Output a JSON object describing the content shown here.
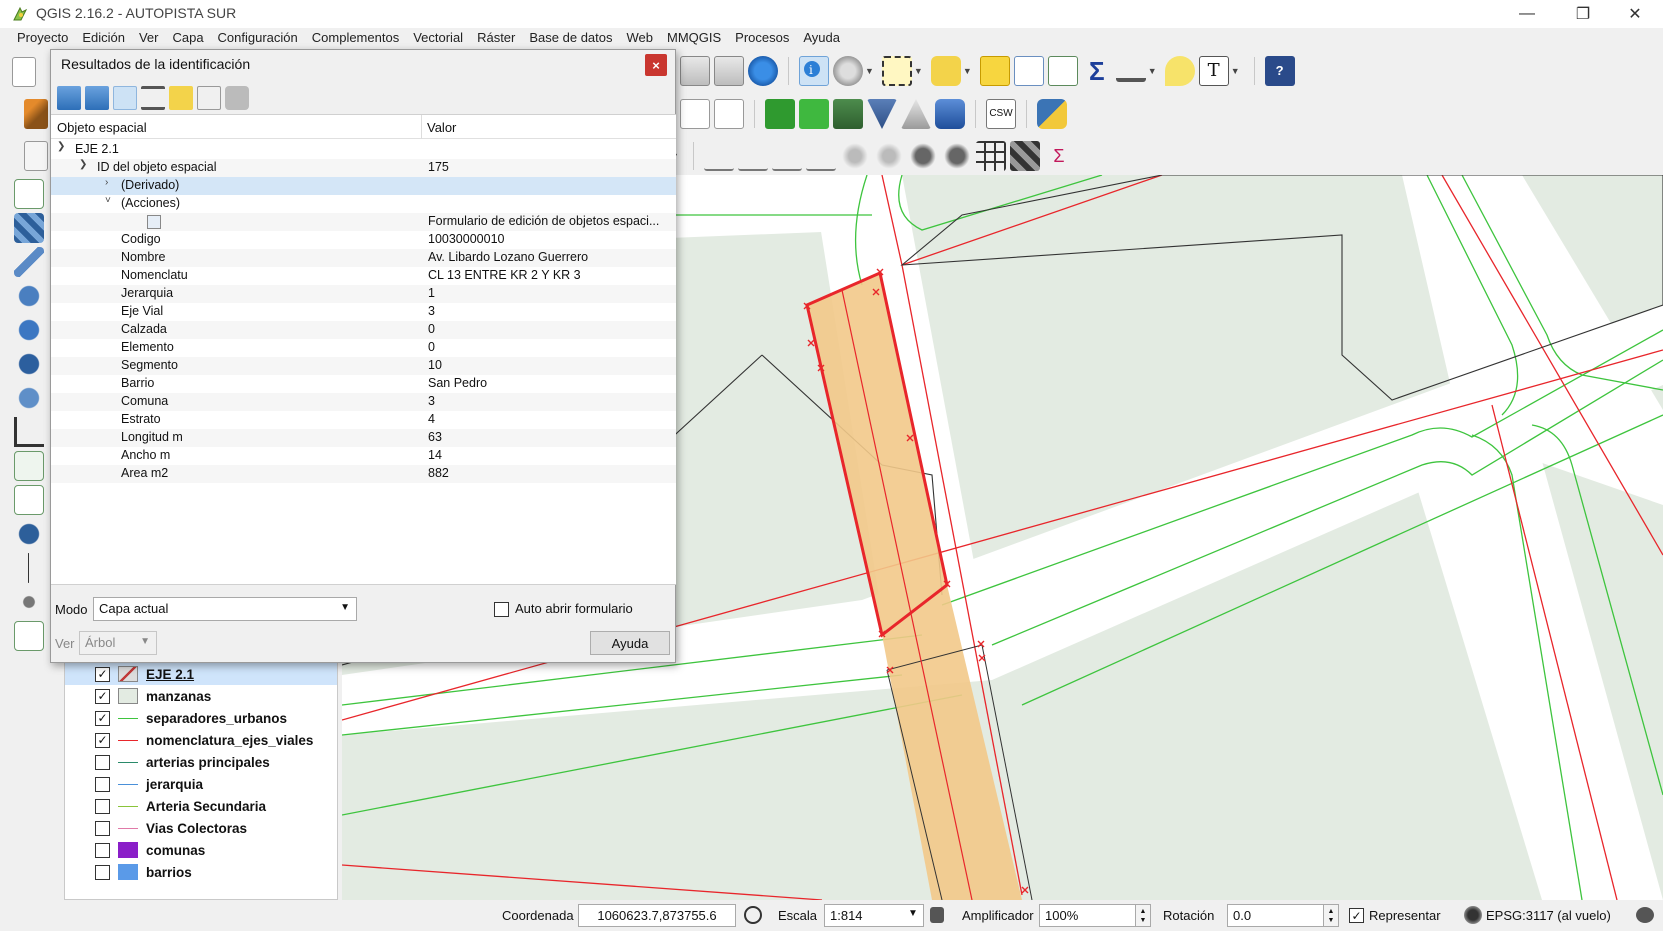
{
  "window": {
    "title": "QGIS 2.16.2 - AUTOPISTA SUR",
    "minimize": "—",
    "restore": "❐",
    "close": "✕"
  },
  "menu": [
    "Proyecto",
    "Edición",
    "Ver",
    "Capa",
    "Configuración",
    "Complementos",
    "Vectorial",
    "Ráster",
    "Base de datos",
    "Web",
    "MMQGIS",
    "Procesos",
    "Ayuda"
  ],
  "toolbar": {
    "csw_label": "CSW",
    "sigma": "Σ",
    "text_tool": "T"
  },
  "identify": {
    "title": "Resultados de la identificación",
    "close_label": "×",
    "col_feature": "Objeto espacial",
    "col_value": "Valor",
    "layer_name": "EJE 2.1",
    "feature_id_label": "ID del objeto espacial",
    "feature_id_value": "175",
    "derived_label": "(Derivado)",
    "actions_label": "(Acciones)",
    "action_value": "Formulario de edición de objetos espaci...",
    "attributes": [
      {
        "name": "Codigo",
        "value": "10030000010"
      },
      {
        "name": "Nombre",
        "value": "Av. Libardo Lozano Guerrero"
      },
      {
        "name": "Nomenclatu",
        "value": "CL 13 ENTRE KR 2 Y KR 3"
      },
      {
        "name": "Jerarquia",
        "value": "1"
      },
      {
        "name": "Eje Vial",
        "value": "3"
      },
      {
        "name": "Calzada",
        "value": "0"
      },
      {
        "name": "Elemento",
        "value": "0"
      },
      {
        "name": "Segmento",
        "value": "10"
      },
      {
        "name": "Barrio",
        "value": "San Pedro"
      },
      {
        "name": "Comuna",
        "value": "3"
      },
      {
        "name": "Estrato",
        "value": "4"
      },
      {
        "name": "Longitud m",
        "value": "63"
      },
      {
        "name": "Ancho m",
        "value": "14"
      },
      {
        "name": "Area m2",
        "value": "882"
      }
    ],
    "mode_label": "Modo",
    "mode_value": "Capa actual",
    "auto_open_label": "Auto abrir formulario",
    "view_label": "Ver",
    "view_value": "Árbol",
    "help_label": "Ayuda"
  },
  "layers": [
    {
      "name": "EJE 2.1",
      "checked": true,
      "symbol": "polygon-stroke",
      "selected": true
    },
    {
      "name": "manzanas",
      "checked": true,
      "symbol": "fill-pale"
    },
    {
      "name": "separadores_urbanos",
      "checked": true,
      "symbol": "line-green"
    },
    {
      "name": "nomenclatura_ejes_viales",
      "checked": true,
      "symbol": "line-red"
    },
    {
      "name": "arterias principales",
      "checked": false,
      "symbol": "line-teal"
    },
    {
      "name": "jerarquia",
      "checked": false,
      "symbol": "line-blue"
    },
    {
      "name": "Arteria Secundaria",
      "checked": false,
      "symbol": "line-lime"
    },
    {
      "name": "Vias Colectoras",
      "checked": false,
      "symbol": "line-pink"
    },
    {
      "name": "comunas",
      "checked": false,
      "symbol": "fill-purple"
    },
    {
      "name": "barrios",
      "checked": false,
      "symbol": "fill-blue"
    }
  ],
  "colors": {
    "road_green": "#3ec43e",
    "axis_red": "#e8262b",
    "block_fill": "#e3ebe2",
    "selection_fill": "#f2c98a",
    "selection_stroke": "#e8262b"
  },
  "status": {
    "coord_label": "Coordenada",
    "coord_value": "1060623.7,873755.6",
    "scale_label": "Escala",
    "scale_value": "1:814",
    "magnifier_label": "Amplificador",
    "magnifier_value": "100%",
    "rotation_label": "Rotación",
    "rotation_value": "0.0",
    "render_label": "Representar",
    "crs_label": "EPSG:3117 (al vuelo)"
  }
}
